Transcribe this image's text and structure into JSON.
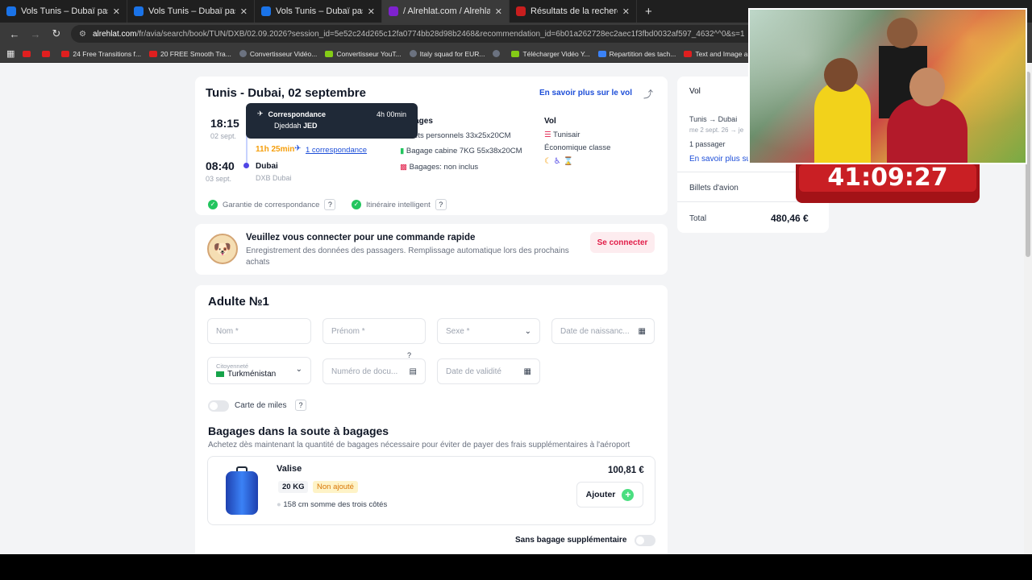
{
  "browser": {
    "tabs": [
      {
        "title": "Vols Tunis – Dubaï pas chers su",
        "fav_color": "#1a73e8",
        "active": false
      },
      {
        "title": "Vols Tunis – Dubaï pas chers su",
        "fav_color": "#1a73e8",
        "active": false
      },
      {
        "title": "Vols Tunis – Dubaï pas chers su",
        "fav_color": "#1a73e8",
        "active": false
      },
      {
        "title": "/ Alrehlat.com / Alrehlat.com",
        "fav_color": "#7e22ce",
        "active": true
      },
      {
        "title": "Résultats de la recherche | Emi",
        "fav_color": "#c81e1e",
        "active": false
      }
    ],
    "url_host": "alrehlat.com",
    "url_path": "/fr/avia/search/book/TUN/DXB/02.09.2026?session_id=5e52c24d265c12fa0774bb28d98b2468&recommendation_id=6b01a262728ec2aec1f3fbd0032af597_4632^^0&s=1",
    "bookmarks": [
      {
        "label": "",
        "icon": "youtube-icon"
      },
      {
        "label": "",
        "icon": "youtube-icon"
      },
      {
        "label": "24 Free Transitions f...",
        "icon": "youtube-icon"
      },
      {
        "label": "20 FREE Smooth Tra...",
        "icon": "youtube-icon"
      },
      {
        "label": "Convertisseur Vidéo...",
        "icon": "globe-icon"
      },
      {
        "label": "Convertisseur YouT...",
        "icon": "download-icon"
      },
      {
        "label": "Italy squad for EUR...",
        "icon": "globe-icon"
      },
      {
        "label": "",
        "icon": "globe-icon"
      },
      {
        "label": "Télécharger Vidéo Y...",
        "icon": "download-icon"
      },
      {
        "label": "Repartition des tach...",
        "icon": "doc-icon"
      },
      {
        "label": "Text and Image ani...",
        "icon": "youtube-icon"
      }
    ]
  },
  "flight": {
    "title": "Tunis - Dubai, 02 septembre",
    "learn_more": "En savoir plus sur le vol",
    "depart_time": "18:15",
    "depart_date": "02 sept.",
    "duration": "11h 25min",
    "connection_link": "1 correspondance",
    "arrive_time": "08:40",
    "arrive_date": "03 sept.",
    "arrive_city": "Dubai",
    "arrive_airport": "DXB Dubai",
    "baggage_title": "gages",
    "baggage_items": [
      "ffets personnels 33x25x20CM",
      "Bagage cabine 7KG 55x38x20CM",
      "Bagages: non inclus"
    ],
    "flight_col_title": "Vol",
    "airline": "Tunisair",
    "cabin_class": "Économique classe",
    "guarantee": "Garantie de correspondance",
    "smart_itinerary": "Itinéraire intelligent",
    "tooltip_title": "Correspondance",
    "tooltip_duration": "4h 00min",
    "tooltip_place": "Djeddah",
    "tooltip_code": "JED"
  },
  "login": {
    "title": "Veuillez vous connecter pour une commande rapide",
    "subtitle": "Enregistrement des données des passagers. Remplissage automatique lors des prochains achats",
    "button": "Se connecter"
  },
  "passenger": {
    "heading": "Adulte №1",
    "nom": "Nom *",
    "prenom": "Prénom *",
    "sexe": "Sexe *",
    "dob": "Date de naissanc...",
    "citizenship_label": "Citoyenneté",
    "citizenship_value": "Turkménistan",
    "doc_number": "Numéro de docu...",
    "validity": "Date de validité",
    "miles_card": "Carte de miles"
  },
  "baggage_section": {
    "title": "Bagages dans la soute à bagages",
    "subtitle": "Achetez dès maintenant la quantité de bagages nécessaire pour éviter de payer des frais supplémentaires à l'aéroport",
    "item_name": "Valise",
    "weight": "20 KG",
    "status": "Non ajouté",
    "dimensions": "158 cm somme des trois côtés",
    "price": "100,81 €",
    "add_button": "Ajouter",
    "no_extra": "Sans bagage supplémentaire"
  },
  "summary": {
    "vol_label": "Vol",
    "route": "Tunis → Dubai",
    "date_line": "me 2 sept. 26 → je",
    "passengers": "1 passager",
    "learn_more": "En savoir plus su",
    "tickets": "Billets d'avion",
    "total_label": "Total",
    "total_value": "480,46 €"
  },
  "overlay": {
    "timer": "41:09:27"
  },
  "colors": {
    "accent_blue": "#1d4ed8",
    "accent_pink": "#e11d48",
    "duration_orange": "#f59e0b",
    "success_green": "#22c55e"
  }
}
